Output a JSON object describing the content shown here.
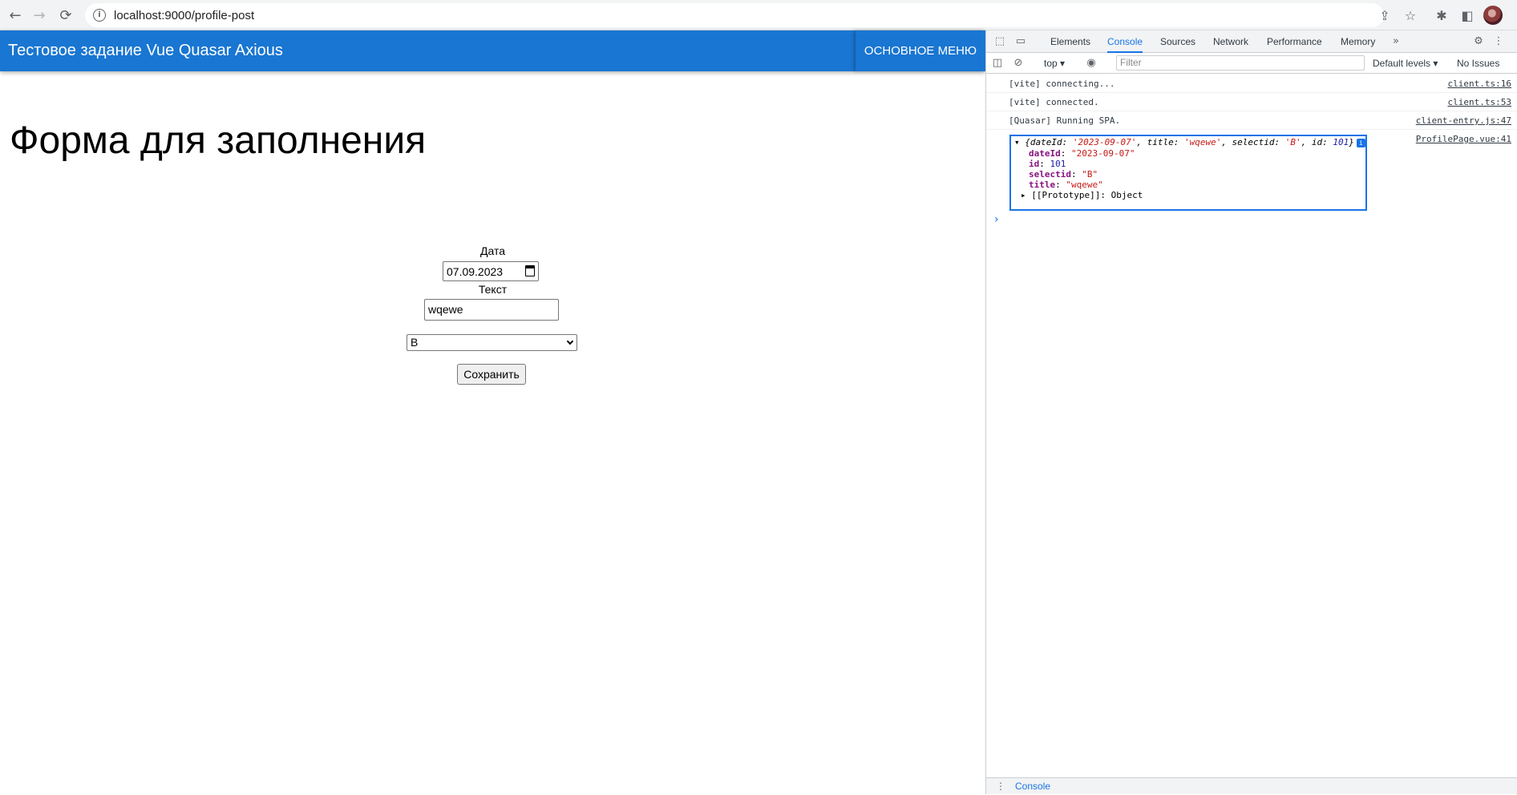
{
  "browser": {
    "url": "localhost:9000/profile-post",
    "nav": {
      "back": "←",
      "forward": "→",
      "reload": "⟳",
      "info": "i"
    }
  },
  "app": {
    "title": "Тестовое задание Vue Quasar Axious",
    "menu_button": "ОСНОВНОЕ МЕНЮ",
    "form_heading": "Форма для заполнения",
    "form": {
      "date_label": "Дата",
      "date_value": "07.09.2023",
      "text_label": "Текст",
      "text_value": "wqewe",
      "select_value": "B",
      "save_label": "Сохранить"
    }
  },
  "devtools": {
    "tabs": [
      "Elements",
      "Console",
      "Sources",
      "Network",
      "Performance",
      "Memory"
    ],
    "active_tab": "Console",
    "more_tabs": "»",
    "context": "top",
    "filter_placeholder": "Filter",
    "levels": "Default levels",
    "issues": "No Issues",
    "logs": [
      {
        "msg": "[vite] connecting...",
        "src": "client.ts:16"
      },
      {
        "msg": "[vite] connected.",
        "src": "client.ts:53"
      },
      {
        "msg": "[Quasar] Running SPA.",
        "src": "client-entry.js:47"
      }
    ],
    "object_log": {
      "src": "ProfilePage.vue:41",
      "summary_prefix": "{dateId: ",
      "summary_date": "'2023-09-07'",
      "summary_mid1": ", title: ",
      "summary_title": "'wqewe'",
      "summary_mid2": ", selectid: ",
      "summary_select": "'B'",
      "summary_mid3": ", id: ",
      "summary_id": "101",
      "summary_end": "}",
      "props": [
        {
          "key": "dateId",
          "value": "\"2023-09-07\"",
          "kind": "string"
        },
        {
          "key": "id",
          "value": "101",
          "kind": "number"
        },
        {
          "key": "selectid",
          "value": "\"B\"",
          "kind": "string"
        },
        {
          "key": "title",
          "value": "\"wqewe\"",
          "kind": "string"
        }
      ],
      "prototype_label": "[[Prototype]]",
      "prototype_value": "Object"
    },
    "drawer_label": "Console"
  }
}
